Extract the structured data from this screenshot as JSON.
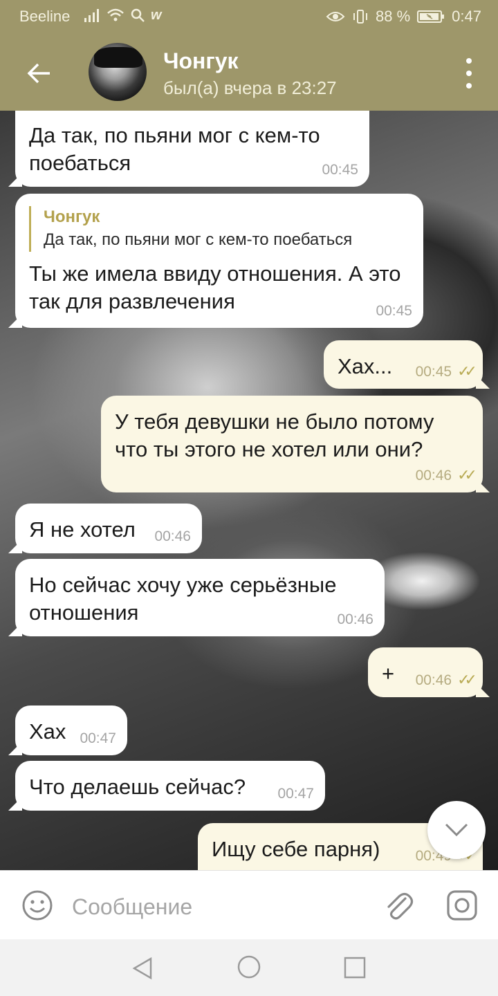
{
  "status_bar": {
    "carrier": "Beeline",
    "battery": "88 %",
    "time": "0:47",
    "icons": [
      "signal-icon",
      "wifi-icon",
      "search-icon",
      "w-app-icon",
      "eye-icon",
      "vibrate-icon",
      "battery-icon"
    ]
  },
  "header": {
    "name": "Чонгук",
    "status": "был(а) вчера в 23:27"
  },
  "messages": [
    {
      "dir": "in",
      "text": "Да так, по пьяни мог с кем-то поебаться",
      "time": "00:45"
    },
    {
      "dir": "in",
      "reply_author": "Чонгук",
      "reply_text": "Да так, по пьяни мог с кем-то поебаться",
      "text": "Ты же имела ввиду отношения. А это так для развлечения",
      "time": "00:45"
    },
    {
      "dir": "out",
      "text": "Хах...",
      "time": "00:45",
      "read": true
    },
    {
      "dir": "out",
      "text": "У тебя девушки не было потому что ты этого не хотел или они?",
      "time": "00:46",
      "read": true
    },
    {
      "dir": "in",
      "text": "Я не хотел",
      "time": "00:46"
    },
    {
      "dir": "in",
      "text": "Но сейчас хочу уже серьёзные отношения",
      "time": "00:46"
    },
    {
      "dir": "out",
      "text": "+",
      "time": "00:46",
      "read": true
    },
    {
      "dir": "in",
      "text": "Хах",
      "time": "00:47"
    },
    {
      "dir": "in",
      "text": "Что делаешь сейчас?",
      "time": "00:47"
    },
    {
      "dir": "out",
      "text": "Ищу себе парня)",
      "time": "00:49",
      "read": true
    }
  ],
  "composer": {
    "placeholder": "Сообщение"
  },
  "colors": {
    "accent": "#9e976a",
    "outgoing_bubble": "#fbf7e4",
    "incoming_bubble": "#ffffff",
    "tick": "#b9ab55"
  }
}
